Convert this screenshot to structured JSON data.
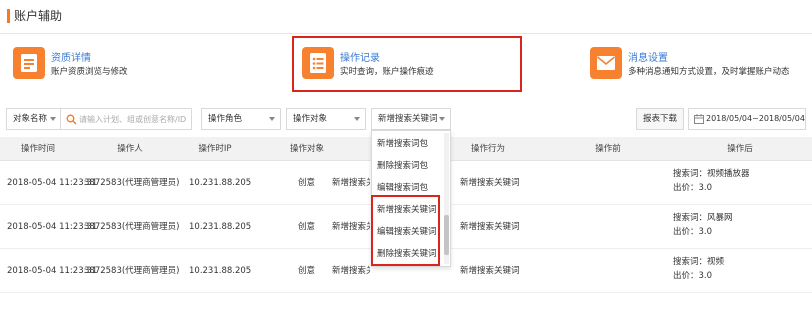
{
  "page": {
    "title": "账户辅助"
  },
  "colors": {
    "accent": "#f47920",
    "link": "#3a7bd5",
    "highlight_border": "#d9261c",
    "icon_bg": "#f7812f"
  },
  "cards": [
    {
      "icon": "document-details-icon",
      "title": "资质详情",
      "desc": "账户资质浏览与修改"
    },
    {
      "icon": "operation-log-icon",
      "title": "操作记录",
      "desc": "实时查询，账户操作痕迹"
    },
    {
      "icon": "envelope-icon",
      "title": "消息设置",
      "desc": "多种消息通知方式设置，及时掌握账户动态"
    }
  ],
  "filters": {
    "object_name": "对象名称",
    "search_placeholder": "请输入计划、组或创意名称/ID",
    "operator_role": "操作角色",
    "operation_object": "操作对象",
    "operation_action": "新增搜索关键词",
    "report_download": "报表下载",
    "date_range": "2018/05/04~2018/05/04"
  },
  "table": {
    "columns": [
      "操作时间",
      "操作人",
      "操作时IP",
      "操作对象",
      "操作行为",
      "操作前",
      "操作后"
    ],
    "rows": [
      {
        "time": "2018-05-04 11:23:31",
        "operator": "3872583(代理商管理员)",
        "ip": "10.231.88.205",
        "object": "创意",
        "object_suffix": "新增搜索关键词",
        "action": "新增搜索关键词",
        "before": "",
        "after_1": "搜索词：视频播放器",
        "after_2": "出价：3.0"
      },
      {
        "time": "2018-05-04 11:23:31",
        "operator": "3872583(代理商管理员)",
        "ip": "10.231.88.205",
        "object": "创意",
        "object_suffix": "新增搜索关键词",
        "action": "新增搜索关键词",
        "before": "",
        "after_1": "搜索词：风暴网",
        "after_2": "出价：3.0"
      },
      {
        "time": "2018-05-04 11:23:31",
        "operator": "3872583(代理商管理员)",
        "ip": "10.231.88.205",
        "object": "创意",
        "object_suffix": "新增搜索关键词",
        "action": "新增搜索关键词",
        "before": "",
        "after_1": "搜索词：视频",
        "after_2": "出价：3.0"
      }
    ]
  },
  "dropdown": {
    "options": [
      "新增搜索词包",
      "删除搜索词包",
      "编辑搜索词包",
      "新增搜索关键词",
      "编辑搜索关键词",
      "删除搜索关键词"
    ]
  }
}
